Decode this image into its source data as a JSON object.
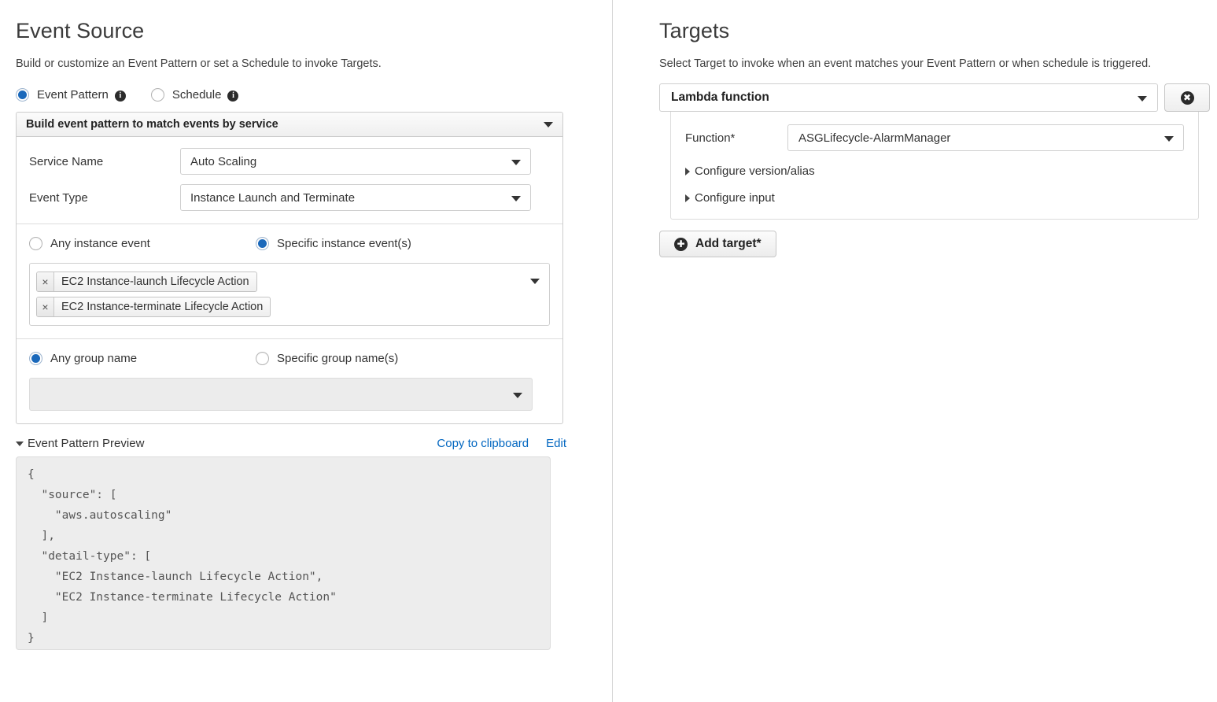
{
  "event_source": {
    "title": "Event Source",
    "description": "Build or customize an Event Pattern or set a Schedule to invoke Targets.",
    "mode_radios": [
      {
        "label": "Event Pattern",
        "selected": true,
        "info_icon": "info-icon"
      },
      {
        "label": "Schedule",
        "selected": false,
        "info_icon": "info-icon"
      }
    ],
    "builder_header": "Build event pattern to match events by service",
    "fields": [
      {
        "label": "Service Name",
        "value": "Auto Scaling"
      },
      {
        "label": "Event Type",
        "value": "Instance Launch and Terminate"
      }
    ],
    "instance_event_radios": [
      {
        "label": "Any instance event",
        "selected": false
      },
      {
        "label": "Specific instance event(s)",
        "selected": true
      }
    ],
    "selected_events": [
      {
        "remove_label": "×",
        "label": "EC2 Instance-launch Lifecycle Action"
      },
      {
        "remove_label": "×",
        "label": "EC2 Instance-terminate Lifecycle Action"
      }
    ],
    "group_name_radios": [
      {
        "label": "Any group name",
        "selected": true
      },
      {
        "label": "Specific group name(s)",
        "selected": false
      }
    ],
    "group_name_value": "",
    "preview": {
      "title": "Event Pattern Preview",
      "copy_link": "Copy to clipboard",
      "edit_link": "Edit",
      "json": "{\n  \"source\": [\n    \"aws.autoscaling\"\n  ],\n  \"detail-type\": [\n    \"EC2 Instance-launch Lifecycle Action\",\n    \"EC2 Instance-terminate Lifecycle Action\"\n  ]\n}"
    }
  },
  "targets": {
    "title": "Targets",
    "description": "Select Target to invoke when an event matches your Event Pattern or when schedule is triggered.",
    "target_type": "Lambda function",
    "delete_glyph": "✖",
    "function_label": "Function*",
    "function_value": "ASGLifecycle-AlarmManager",
    "disclosures": [
      {
        "label": "Configure version/alias"
      },
      {
        "label": "Configure input"
      }
    ],
    "add_target_label": "Add target*",
    "add_target_glyph": "✚"
  },
  "colors": {
    "link": "#0166c0",
    "radio_selected": "#1a68ba",
    "preview_bg": "#ededed"
  }
}
